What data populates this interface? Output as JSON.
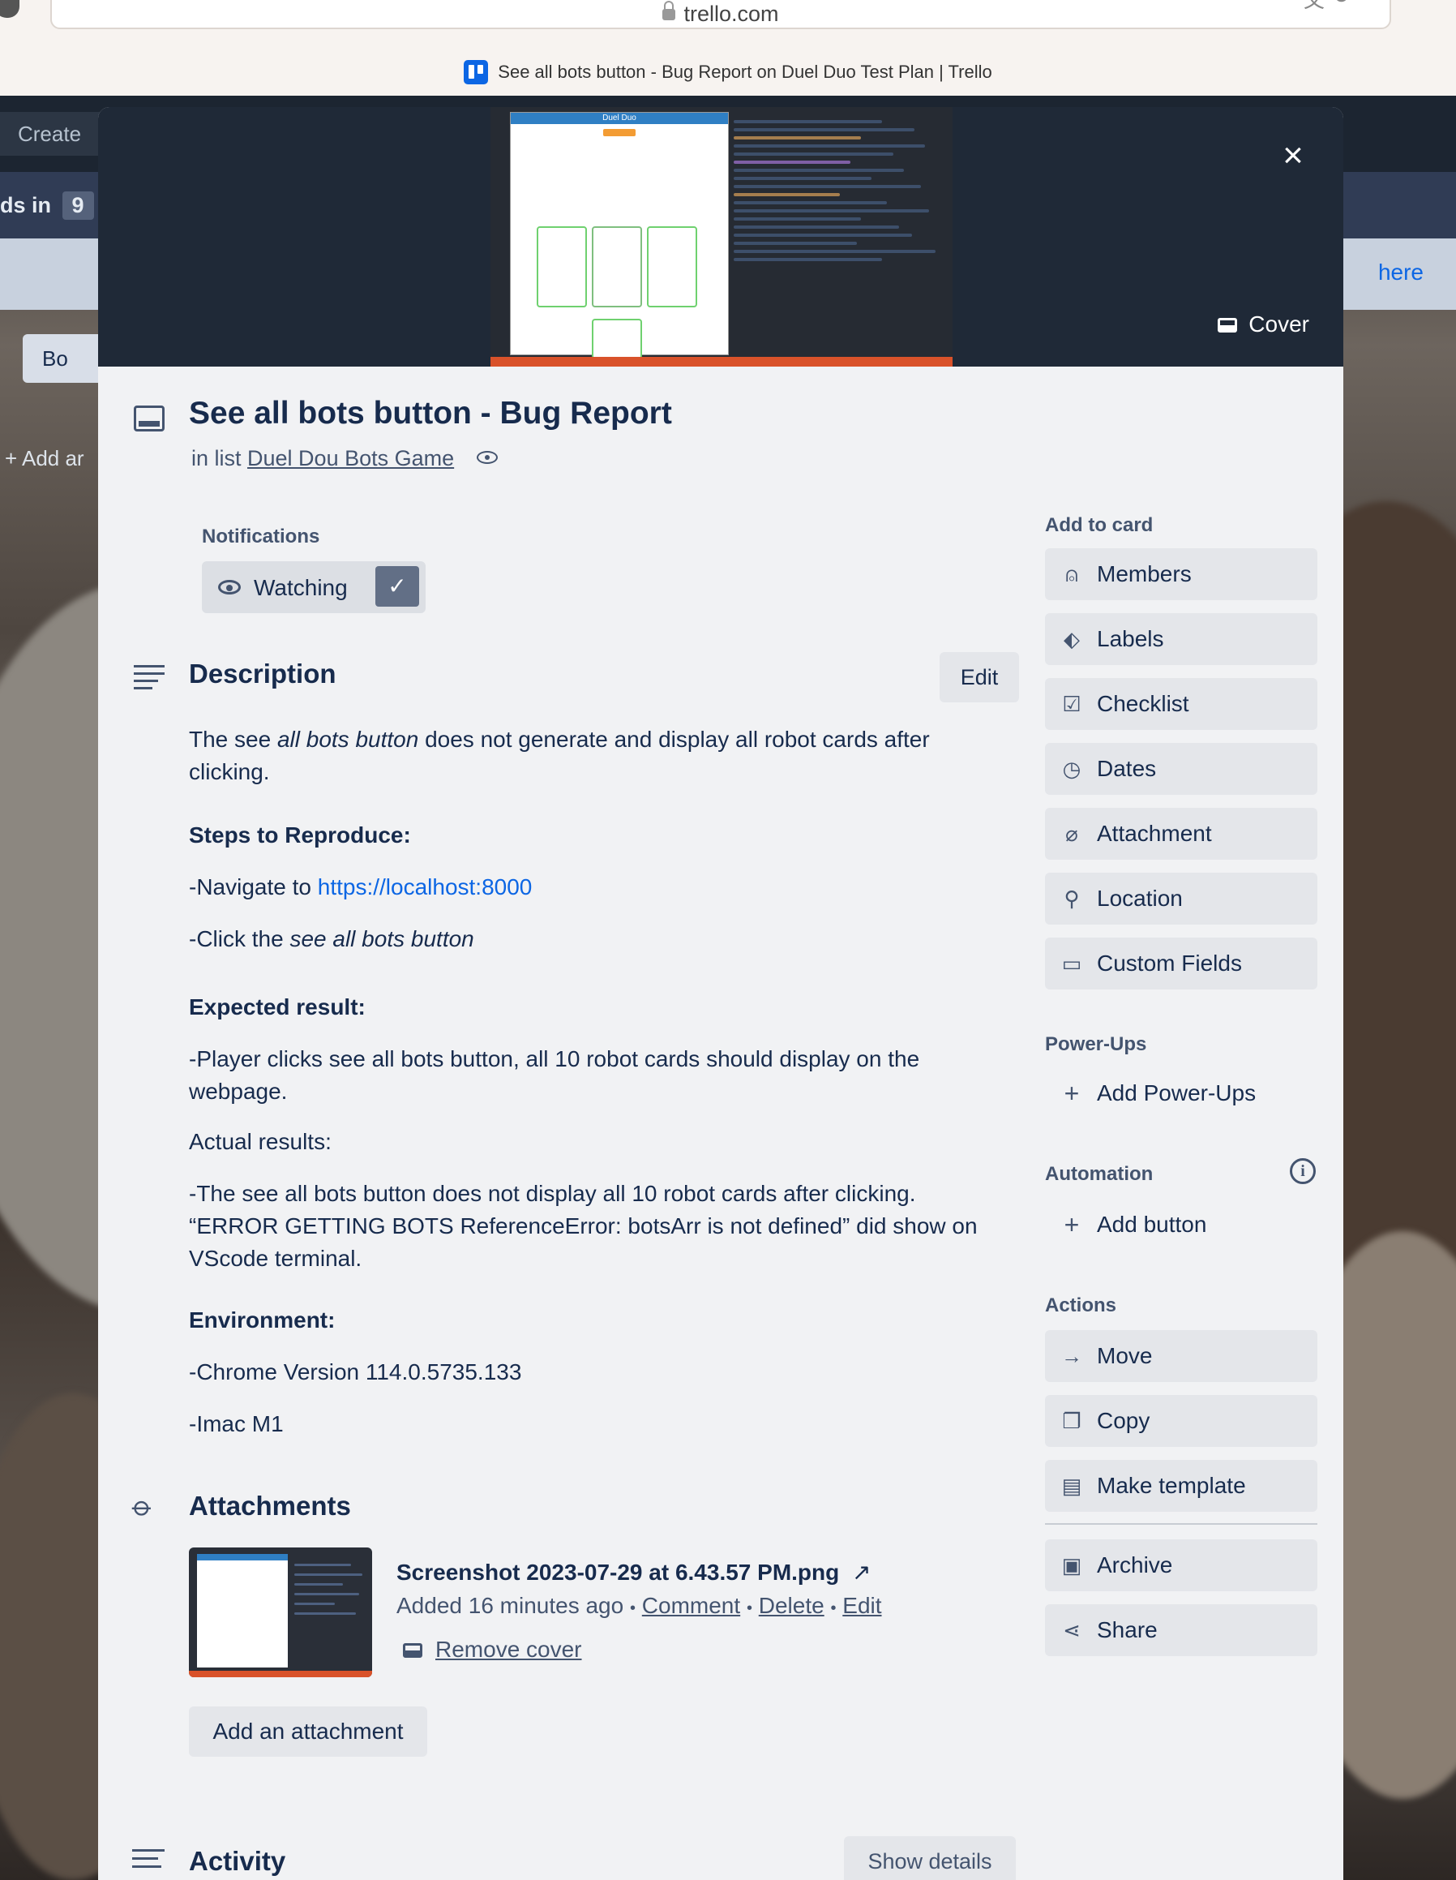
{
  "browser": {
    "url": "trello.com",
    "tab_title": "See all bots button - Bug Report on Duel Duo Test Plan | Trello"
  },
  "board": {
    "create_label": "Create",
    "cards_in_label": "ds in",
    "cards_count": "9",
    "banner_link": "here",
    "view_label": "Bo",
    "add_another_label": "+ Add ar"
  },
  "cover": {
    "cover_button_label": "Cover",
    "preview_app_title": "Duel Duo"
  },
  "card": {
    "title": "See all bots button - Bug Report",
    "in_list_prefix": "in list",
    "list_name": "Duel Dou Bots Game"
  },
  "notifications": {
    "label": "Notifications",
    "watching_label": "Watching",
    "check_glyph": "✓"
  },
  "description": {
    "title": "Description",
    "edit_label": "Edit",
    "intro_prefix": "The see ",
    "intro_italic": "all bots button",
    "intro_suffix": " does not generate and display all robot cards after clicking.",
    "steps_heading": "Steps to Reproduce:",
    "step1_prefix": "-Navigate to ",
    "step1_link": "https://localhost:8000",
    "step2_prefix": "-Click the ",
    "step2_italic": "see all bots button",
    "expected_heading": "Expected result:",
    "expected_text": "-Player clicks see all bots button, all 10 robot cards should display on the webpage.",
    "actual_heading": "Actual results:",
    "actual_text": "-The see all bots button does not display all 10 robot cards after clicking. “ERROR GETTING BOTS ReferenceError: botsArr is not defined” did show on VScode terminal.",
    "environment_heading": "Environment:",
    "env1": "-Chrome Version 114.0.5735.133",
    "env2": "-Imac M1"
  },
  "attachments": {
    "title": "Attachments",
    "file_name": "Screenshot 2023-07-29 at 6.43.57 PM.png",
    "open_glyph": "↗",
    "added": "Added 16 minutes ago",
    "sep": "•",
    "comment_label": "Comment",
    "delete_label": "Delete",
    "edit_label": "Edit",
    "remove_cover_label": "Remove cover",
    "add_attachment_label": "Add an attachment"
  },
  "activity": {
    "title": "Activity",
    "show_details_label": "Show details"
  },
  "sidebar": {
    "add_to_card_label": "Add to card",
    "add_to_card": [
      {
        "label": "Members",
        "icon": "person-icon",
        "glyph": "⍝"
      },
      {
        "label": "Labels",
        "icon": "tag-icon",
        "glyph": "⬖"
      },
      {
        "label": "Checklist",
        "icon": "checklist-icon",
        "glyph": "☑"
      },
      {
        "label": "Dates",
        "icon": "clock-icon",
        "glyph": "◷"
      },
      {
        "label": "Attachment",
        "icon": "paperclip-icon",
        "glyph": "⌀"
      },
      {
        "label": "Location",
        "icon": "pin-icon",
        "glyph": "⚲"
      },
      {
        "label": "Custom Fields",
        "icon": "fields-icon",
        "glyph": "▭"
      }
    ],
    "powerups_label": "Power-Ups",
    "add_powerups_label": "Add Power-Ups",
    "automation_label": "Automation",
    "add_button_label": "Add button",
    "actions_label": "Actions",
    "actions": [
      {
        "label": "Move",
        "icon": "arrow-right-icon",
        "glyph": "→"
      },
      {
        "label": "Copy",
        "icon": "copy-icon",
        "glyph": "❐"
      },
      {
        "label": "Make template",
        "icon": "template-icon",
        "glyph": "▤"
      }
    ],
    "archive_label": "Archive",
    "share_label": "Share"
  }
}
